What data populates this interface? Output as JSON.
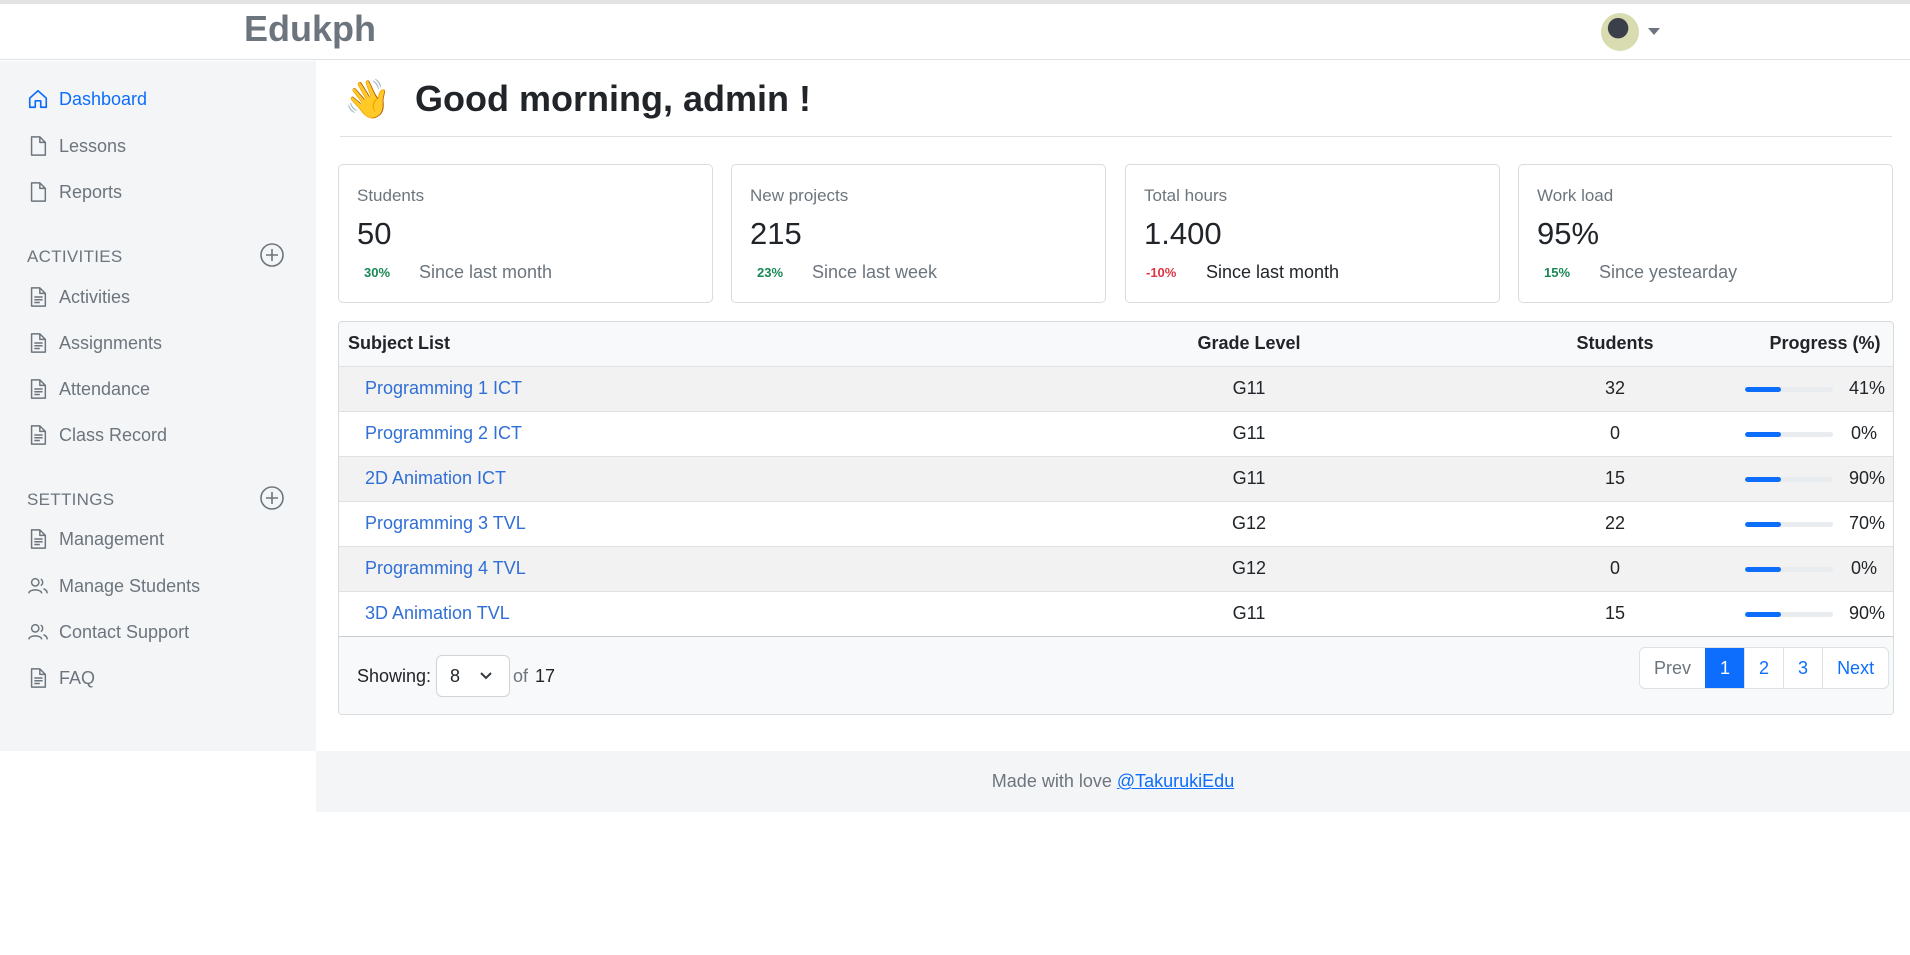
{
  "brand": "Edukph",
  "sidebar": {
    "top_items": [
      {
        "label": "Dashboard"
      },
      {
        "label": "Lessons"
      },
      {
        "label": "Reports"
      }
    ],
    "activities_heading": "ACTIVITIES",
    "activities_items": [
      {
        "label": "Activities"
      },
      {
        "label": "Assignments"
      },
      {
        "label": "Attendance"
      },
      {
        "label": "Class Record"
      }
    ],
    "settings_heading": "SETTINGS",
    "settings_items": [
      {
        "label": "Management"
      },
      {
        "label": "Manage Students"
      },
      {
        "label": "Contact Support"
      },
      {
        "label": "FAQ"
      }
    ]
  },
  "greeting": {
    "emoji": "👋",
    "text": "Good morning, admin !"
  },
  "cards": [
    {
      "title": "Students",
      "value": "50",
      "change": "30%",
      "trend": "up",
      "since": "Since last month"
    },
    {
      "title": "New projects",
      "value": "215",
      "change": "23%",
      "trend": "up",
      "since": "Since last week"
    },
    {
      "title": "Total hours",
      "value": "1.400",
      "change": "-10%",
      "trend": "down",
      "since": "Since last month"
    },
    {
      "title": "Work load",
      "value": "95%",
      "change": "15%",
      "trend": "up",
      "since": "Since yestearday"
    }
  ],
  "table": {
    "headers": {
      "subject": "Subject List",
      "grade": "Grade Level",
      "students": "Students",
      "progress": "Progress (%)"
    },
    "rows": [
      {
        "subject": "Programming 1 ICT",
        "grade": "G11",
        "students": "32",
        "progress": "41%",
        "bar_fill": 0.41
      },
      {
        "subject": "Programming 2 ICT",
        "grade": "G11",
        "students": "0",
        "progress": "0%",
        "bar_fill": 0.41
      },
      {
        "subject": "2D Animation ICT",
        "grade": "G11",
        "students": "15",
        "progress": "90%",
        "bar_fill": 0.41
      },
      {
        "subject": "Programming 3 TVL",
        "grade": "G12",
        "students": "22",
        "progress": "70%",
        "bar_fill": 0.41
      },
      {
        "subject": "Programming 4 TVL",
        "grade": "G12",
        "students": "0",
        "progress": "0%",
        "bar_fill": 0.41
      },
      {
        "subject": "3D Animation TVL",
        "grade": "G11",
        "students": "15",
        "progress": "90%",
        "bar_fill": 0.41
      }
    ]
  },
  "pagination": {
    "showing_label": "Showing:",
    "page_size": "8",
    "of_label": "of",
    "total": "17",
    "prev": "Prev",
    "pages": [
      "1",
      "2",
      "3"
    ],
    "current": "1",
    "next": "Next"
  },
  "footer": {
    "text": "Made with love",
    "link": "@TakurukiEdu"
  },
  "colors": {
    "accent": "#0d6efd",
    "up": "#198754",
    "down": "#dc3545",
    "sidebar_bg": "#f4f5f7"
  }
}
